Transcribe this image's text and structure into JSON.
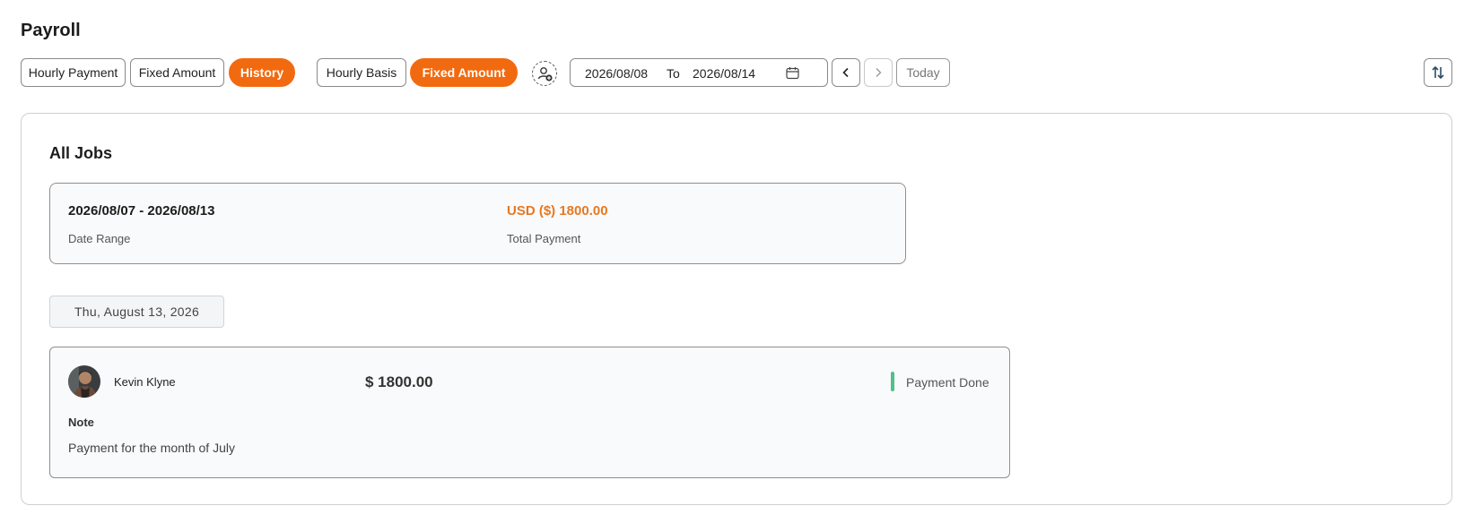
{
  "page": {
    "title": "Payroll"
  },
  "toolbar": {
    "tabs_left": [
      {
        "label": "Hourly Payment",
        "active": false
      },
      {
        "label": "Fixed Amount",
        "active": false
      },
      {
        "label": "History",
        "active": true
      }
    ],
    "tabs_right": [
      {
        "label": "Hourly Basis",
        "active": false
      },
      {
        "label": "Fixed Amount",
        "active": true
      }
    ],
    "assign_icon": "user-add-icon",
    "date_from": "2026/08/08",
    "date_to_label": "To",
    "date_to": "2026/08/14",
    "calendar_icon": "calendar-icon",
    "prev_icon": "chevron-left-icon",
    "next_icon": "chevron-right-icon",
    "today_label": "Today",
    "sort_icon": "sort-icon"
  },
  "main": {
    "section_title": "All Jobs",
    "summary": {
      "date_range": "2026/08/07 - 2026/08/13",
      "date_range_label": "Date Range",
      "total_payment": "USD ($) 1800.00",
      "total_payment_label": "Total Payment"
    },
    "day_header": "Thu, August 13, 2026",
    "entry": {
      "name": "Kevin Klyne",
      "amount": "$ 1800.00",
      "status": "Payment Done",
      "note_label": "Note",
      "note_text": "Payment for the month of July"
    }
  },
  "colors": {
    "accent": "#f26a10",
    "total_payment": "#e8781f",
    "status_done": "#4fc189"
  }
}
